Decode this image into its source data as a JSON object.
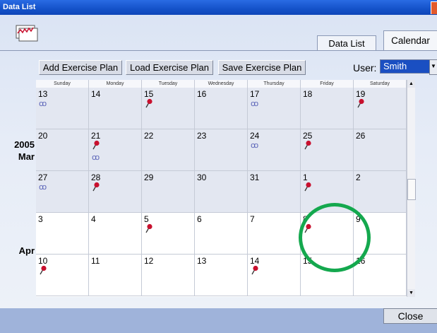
{
  "window": {
    "title": "Data List"
  },
  "tabs": {
    "data_list": "Data List",
    "calendar": "Calendar"
  },
  "toolbar": {
    "add": "Add Exercise Plan",
    "load": "Load Exercise Plan",
    "save": "Save Exercise Plan",
    "user_label": "User:",
    "user_value": "Smith"
  },
  "calendar": {
    "weekdays": [
      "Sunday",
      "Monday",
      "Tuesday",
      "Wednesday",
      "Thursday",
      "Friday",
      "Saturday"
    ],
    "year": "2005",
    "months": [
      "Mar",
      "Apr"
    ],
    "weeks": [
      {
        "month": "Mar",
        "days": [
          {
            "d": "13",
            "pin": false,
            "run": true
          },
          {
            "d": "14",
            "pin": false,
            "run": false
          },
          {
            "d": "15",
            "pin": true,
            "run": false
          },
          {
            "d": "16",
            "pin": false,
            "run": false
          },
          {
            "d": "17",
            "pin": false,
            "run": true
          },
          {
            "d": "18",
            "pin": false,
            "run": false
          },
          {
            "d": "19",
            "pin": true,
            "run": false
          }
        ]
      },
      {
        "month": "Mar",
        "days": [
          {
            "d": "20",
            "pin": false,
            "run": false
          },
          {
            "d": "21",
            "pin": true,
            "run": true
          },
          {
            "d": "22",
            "pin": false,
            "run": false
          },
          {
            "d": "23",
            "pin": false,
            "run": false
          },
          {
            "d": "24",
            "pin": false,
            "run": true
          },
          {
            "d": "25",
            "pin": true,
            "run": false
          },
          {
            "d": "26",
            "pin": false,
            "run": false
          }
        ]
      },
      {
        "month": "Mar",
        "days": [
          {
            "d": "27",
            "pin": false,
            "run": true
          },
          {
            "d": "28",
            "pin": true,
            "run": false
          },
          {
            "d": "29",
            "pin": false,
            "run": false
          },
          {
            "d": "30",
            "pin": false,
            "run": false
          },
          {
            "d": "31",
            "pin": false,
            "run": false
          },
          {
            "d": "1",
            "pin": true,
            "run": false
          },
          {
            "d": "2",
            "pin": false,
            "run": false
          }
        ]
      },
      {
        "month": "Apr",
        "days": [
          {
            "d": "3",
            "pin": false,
            "run": false
          },
          {
            "d": "4",
            "pin": false,
            "run": false
          },
          {
            "d": "5",
            "pin": true,
            "run": false
          },
          {
            "d": "6",
            "pin": false,
            "run": false
          },
          {
            "d": "7",
            "pin": false,
            "run": false
          },
          {
            "d": "8",
            "pin": true,
            "run": false
          },
          {
            "d": "9",
            "pin": false,
            "run": false
          }
        ]
      },
      {
        "month": "Apr",
        "days": [
          {
            "d": "10",
            "pin": true,
            "run": false
          },
          {
            "d": "11",
            "pin": false,
            "run": false
          },
          {
            "d": "12",
            "pin": false,
            "run": false
          },
          {
            "d": "13",
            "pin": false,
            "run": false
          },
          {
            "d": "14",
            "pin": true,
            "run": false
          },
          {
            "d": "15",
            "pin": false,
            "run": false
          },
          {
            "d": "16",
            "pin": false,
            "run": false
          }
        ]
      }
    ],
    "run_icon_glyph": "ꝏ",
    "colors": {
      "march_bg": "#e3e7f1",
      "april_bg": "#ffffff",
      "pin": "#c8102e",
      "run": "#5a63b8",
      "highlight": "#14a84e"
    }
  },
  "footer": {
    "close": "Close"
  }
}
